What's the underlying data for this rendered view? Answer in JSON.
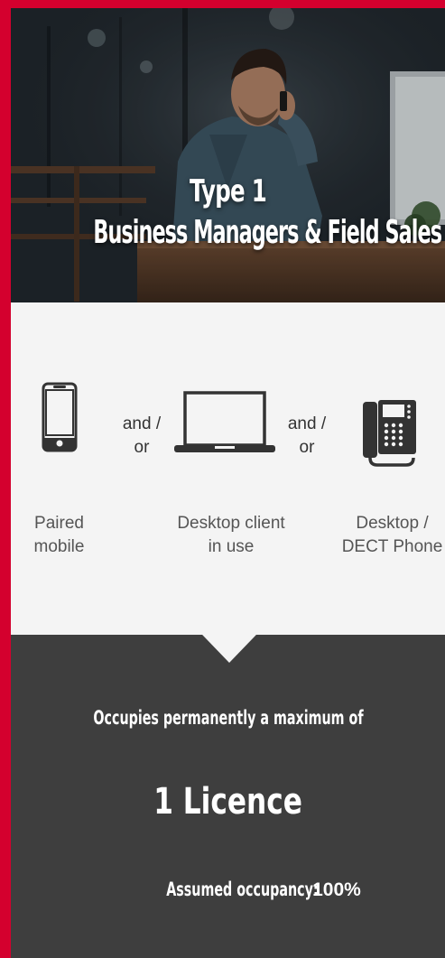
{
  "hero": {
    "title_line1": "Type 1",
    "title_line2": "Business Managers & Field Sales"
  },
  "devices": [
    {
      "icon": "mobile-phone-icon",
      "label_line1": "Paired",
      "label_line2": "mobile"
    },
    {
      "icon": "laptop-icon",
      "label_line1": "Desktop client",
      "label_line2": "in use"
    },
    {
      "icon": "desk-phone-icon",
      "label_line1": "Desktop /",
      "label_line2": "DECT Phone"
    }
  ],
  "connectors": [
    {
      "line1": "and /",
      "line2": "or"
    },
    {
      "line1": "and /",
      "line2": "or"
    }
  ],
  "summary": {
    "heading": "Occupies permanently a maximum of",
    "licence": "1 Licence",
    "occupancy_label": "Assumed occupancy:",
    "occupancy_value": "100%"
  },
  "colors": {
    "frame": "#d4002e",
    "panel_light": "#f4f4f4",
    "panel_dark": "#3e3e3e",
    "icon": "#333333"
  }
}
